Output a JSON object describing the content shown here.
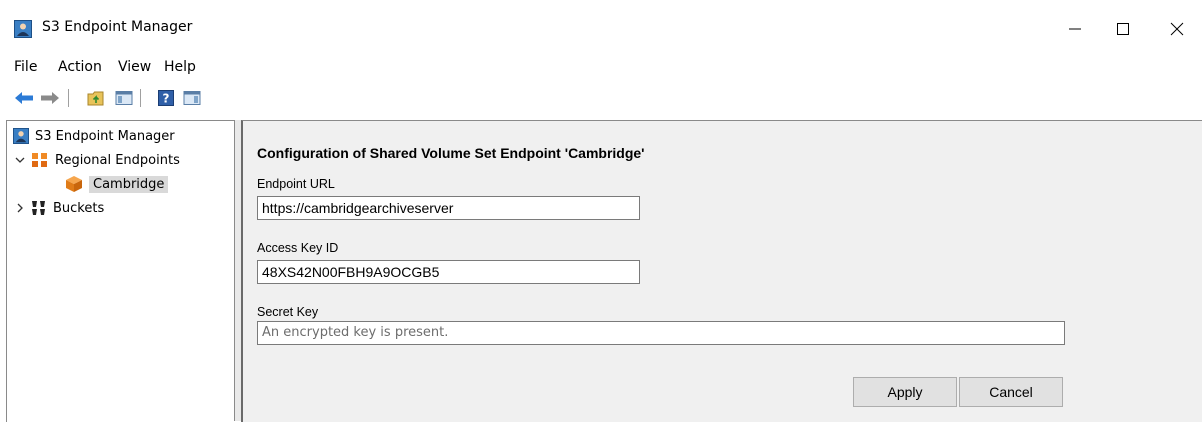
{
  "window": {
    "title": "S3 Endpoint Manager",
    "controls": {
      "minimize": "—",
      "maximize": "☐",
      "close": "✕"
    }
  },
  "menu": {
    "items": [
      "File",
      "Action",
      "View",
      "Help"
    ]
  },
  "toolbar": {
    "buttons": [
      "back-arrow-icon",
      "forward-arrow-icon",
      "up-folder-icon",
      "show-hide-console-tree-icon",
      "help-icon",
      "show-hide-action-pane-icon"
    ]
  },
  "tree": {
    "items": [
      {
        "label": "S3 Endpoint Manager",
        "icon": "console-root-icon",
        "level": 0
      },
      {
        "label": "Regional Endpoints",
        "icon": "regional-endpoints-icon",
        "level": 1,
        "expanded": true
      },
      {
        "label": "Cambridge",
        "icon": "endpoint-cube-icon",
        "level": 2,
        "selected": true
      },
      {
        "label": "Buckets",
        "icon": "buckets-icon",
        "level": 1,
        "expanded": false
      }
    ]
  },
  "config": {
    "title": "Configuration of Shared Volume Set Endpoint 'Cambridge'",
    "endpoint_url_label": "Endpoint URL",
    "endpoint_url_value": "https://cambridgearchiveserver",
    "access_key_label": "Access Key ID",
    "access_key_value": "48XS42N00FBH9A9OCGB5",
    "secret_key_label": "Secret Key",
    "secret_key_value": "An encrypted key is present.",
    "apply_label": "Apply",
    "cancel_label": "Cancel"
  },
  "colors": {
    "accent_blue": "#1e73c8",
    "endpoint_orange": "#f08a24",
    "selection_gray": "#d9d9d9",
    "pane_bg": "#f0f0f0"
  }
}
